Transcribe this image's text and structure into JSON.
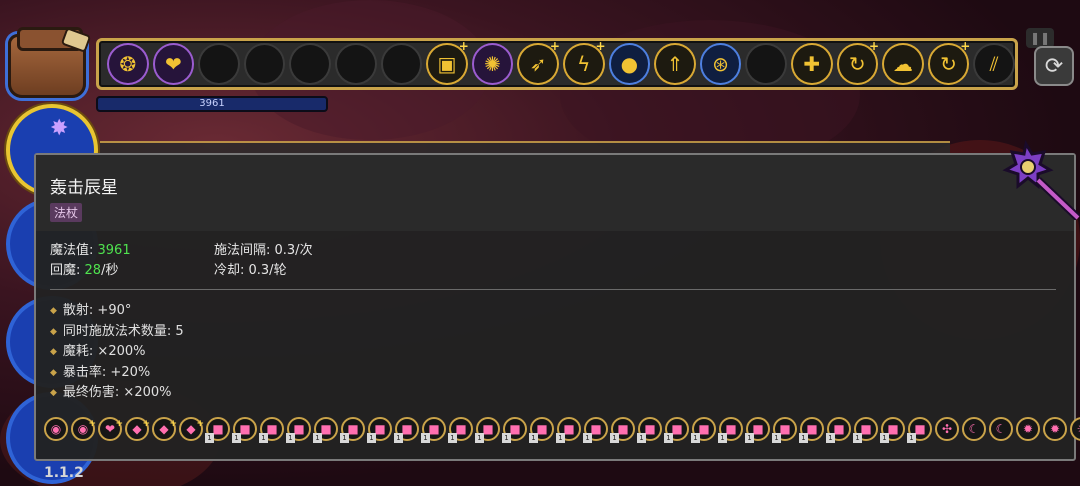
{
  "top_bar": {
    "mana_value": "3961",
    "slots": [
      {
        "icon": "web-icon",
        "glyph": "❂",
        "style": "purple",
        "plus": false
      },
      {
        "icon": "flesh-icon",
        "glyph": "❤",
        "style": "purple",
        "plus": false
      },
      {
        "icon": "empty-slot",
        "glyph": "",
        "style": "",
        "plus": false
      },
      {
        "icon": "empty-slot",
        "glyph": "",
        "style": "",
        "plus": false
      },
      {
        "icon": "empty-slot",
        "glyph": "",
        "style": "",
        "plus": false
      },
      {
        "icon": "empty-slot",
        "glyph": "",
        "style": "",
        "plus": false
      },
      {
        "icon": "empty-slot",
        "glyph": "",
        "style": "",
        "plus": false
      },
      {
        "icon": "card-icon",
        "glyph": "▣",
        "style": "gold",
        "plus": true
      },
      {
        "icon": "lightning-burst-icon",
        "glyph": "✺",
        "style": "purple",
        "plus": false
      },
      {
        "icon": "fire-arrow-icon",
        "glyph": "➶",
        "style": "gold",
        "plus": true
      },
      {
        "icon": "zigzag-icon",
        "glyph": "ϟ",
        "style": "gold",
        "plus": true
      },
      {
        "icon": "orb-icon",
        "glyph": "●",
        "style": "blue",
        "plus": false
      },
      {
        "icon": "triple-arrow-icon",
        "glyph": "⇑",
        "style": "gold",
        "plus": false
      },
      {
        "icon": "coin-icon",
        "glyph": "⊛",
        "style": "blue",
        "plus": false
      },
      {
        "icon": "empty-slot",
        "glyph": "",
        "style": "",
        "plus": false
      },
      {
        "icon": "cross-icon",
        "glyph": "✚",
        "style": "gold",
        "plus": false
      },
      {
        "icon": "swirl-icon",
        "glyph": "↻",
        "style": "gold",
        "plus": true
      },
      {
        "icon": "ghost-icon",
        "glyph": "☁",
        "style": "gold",
        "plus": false
      },
      {
        "icon": "swirl-icon",
        "glyph": "↻",
        "style": "gold",
        "plus": true
      },
      {
        "icon": "slash-icon",
        "glyph": "⫽",
        "style": "",
        "plus": false
      }
    ]
  },
  "tooltip": {
    "name": "轰击辰星",
    "type": "法杖",
    "mana_label": "魔法值: ",
    "mana": "3961",
    "regen_label": "回魔: ",
    "regen": "28",
    "regen_unit": "/秒",
    "cast_interval": "施法间隔: 0.3/次",
    "cooldown": "冷却: 0.3/轮",
    "bonuses": [
      "散射: +90°",
      "同时施放法术数量: 5",
      "魔耗: ×200%",
      "暴击率: +20%",
      "最终伤害: ×200%"
    ]
  },
  "spell_row": [
    {
      "icon": "emerald-icon",
      "glyph": "◉",
      "badge": "",
      "plus": false
    },
    {
      "icon": "emerald-icon",
      "glyph": "◉",
      "badge": "",
      "plus": true
    },
    {
      "icon": "flesh-icon",
      "glyph": "❤",
      "badge": "",
      "plus": true
    },
    {
      "icon": "gem-icon",
      "glyph": "◆",
      "badge": "",
      "plus": true
    },
    {
      "icon": "gem-icon",
      "glyph": "◆",
      "badge": "",
      "plus": true
    },
    {
      "icon": "gem-icon",
      "glyph": "◆",
      "badge": "",
      "plus": true
    },
    {
      "icon": "pink-cube-icon",
      "glyph": "■",
      "badge": "1",
      "plus": false
    },
    {
      "icon": "pink-cube-icon",
      "glyph": "■",
      "badge": "1",
      "plus": false
    },
    {
      "icon": "pink-cube-icon",
      "glyph": "■",
      "badge": "1",
      "plus": false
    },
    {
      "icon": "pink-cube-icon",
      "glyph": "■",
      "badge": "1",
      "plus": false
    },
    {
      "icon": "pink-cube-icon",
      "glyph": "■",
      "badge": "1",
      "plus": false
    },
    {
      "icon": "pink-cube-icon",
      "glyph": "■",
      "badge": "1",
      "plus": false
    },
    {
      "icon": "pink-cube-icon",
      "glyph": "■",
      "badge": "1",
      "plus": false
    },
    {
      "icon": "pink-cube-icon",
      "glyph": "■",
      "badge": "1",
      "plus": false
    },
    {
      "icon": "pink-cube-icon",
      "glyph": "■",
      "badge": "1",
      "plus": false
    },
    {
      "icon": "pink-cube-icon",
      "glyph": "■",
      "badge": "1",
      "plus": false
    },
    {
      "icon": "pink-cube-icon",
      "glyph": "■",
      "badge": "1",
      "plus": false
    },
    {
      "icon": "pink-cube-icon",
      "glyph": "■",
      "badge": "1",
      "plus": false
    },
    {
      "icon": "pink-cube-icon",
      "glyph": "■",
      "badge": "1",
      "plus": false
    },
    {
      "icon": "pink-cube-icon",
      "glyph": "■",
      "badge": "1",
      "plus": false
    },
    {
      "icon": "pink-cube-icon",
      "glyph": "■",
      "badge": "1",
      "plus": false
    },
    {
      "icon": "pink-cube-icon",
      "glyph": "■",
      "badge": "1",
      "plus": false
    },
    {
      "icon": "pink-cube-icon",
      "glyph": "■",
      "badge": "1",
      "plus": false
    },
    {
      "icon": "pink-cube-icon",
      "glyph": "■",
      "badge": "1",
      "plus": false
    },
    {
      "icon": "pink-cube-icon",
      "glyph": "■",
      "badge": "1",
      "plus": false
    },
    {
      "icon": "pink-cube-icon",
      "glyph": "■",
      "badge": "1",
      "plus": false
    },
    {
      "icon": "pink-cube-icon",
      "glyph": "■",
      "badge": "1",
      "plus": false
    },
    {
      "icon": "pink-cube-icon",
      "glyph": "■",
      "badge": "1",
      "plus": false
    },
    {
      "icon": "pink-cube-icon",
      "glyph": "■",
      "badge": "1",
      "plus": false
    },
    {
      "icon": "pink-cube-icon",
      "glyph": "■",
      "badge": "1",
      "plus": false
    },
    {
      "icon": "pink-cube-icon",
      "glyph": "■",
      "badge": "1",
      "plus": false
    },
    {
      "icon": "pink-cube-icon",
      "glyph": "■",
      "badge": "1",
      "plus": false
    },
    {
      "icon": "pink-cube-icon",
      "glyph": "■",
      "badge": "1",
      "plus": false
    },
    {
      "icon": "red-rune-icon",
      "glyph": "✣",
      "badge": "",
      "plus": false
    },
    {
      "icon": "crescent-icon",
      "glyph": "☾",
      "badge": "",
      "plus": false
    },
    {
      "icon": "crescent-icon",
      "glyph": "☾",
      "badge": "",
      "plus": false
    },
    {
      "icon": "flame-icon",
      "glyph": "✹",
      "badge": "",
      "plus": false
    },
    {
      "icon": "flame-icon",
      "glyph": "✹",
      "badge": "",
      "plus": false
    },
    {
      "icon": "sun-eye-icon",
      "glyph": "☼",
      "badge": "",
      "plus": false
    },
    {
      "icon": "flame-icon",
      "glyph": "✹",
      "badge": "",
      "plus": false
    }
  ],
  "version": "1.1.2"
}
